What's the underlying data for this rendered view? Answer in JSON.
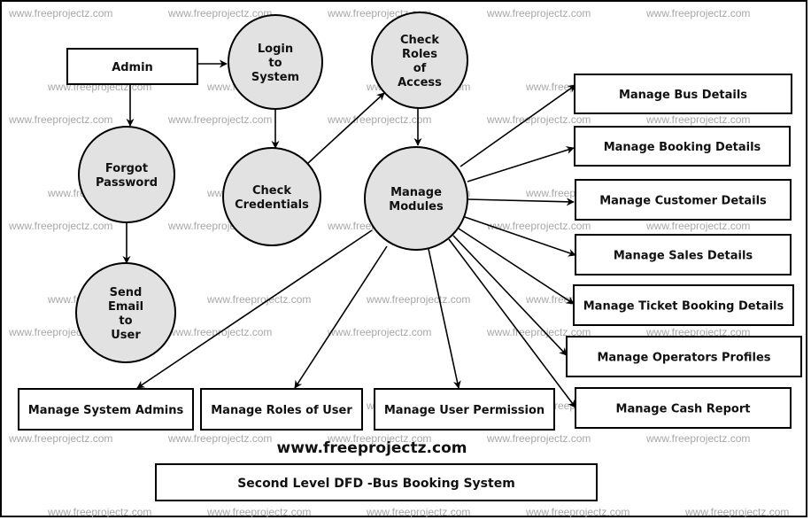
{
  "diagram": {
    "type": "Data Flow Diagram",
    "title": "Second Level DFD -Bus Booking System",
    "website": "www.freeprojectz.com",
    "watermark": "www.freeprojectz.com",
    "colors": {
      "process_fill": "#e2e2e2",
      "stroke": "#000000",
      "watermark": "#a8a8a8",
      "background": "#ffffff"
    },
    "entities": [
      {
        "id": "admin",
        "label": "Admin"
      },
      {
        "id": "bus",
        "label": "Manage Bus Details"
      },
      {
        "id": "booking",
        "label": "Manage Booking Details"
      },
      {
        "id": "customer",
        "label": "Manage Customer Details"
      },
      {
        "id": "sales",
        "label": "Manage Sales Details"
      },
      {
        "id": "ticket",
        "label": "Manage Ticket Booking Details"
      },
      {
        "id": "operators",
        "label": "Manage Operators Profiles"
      },
      {
        "id": "cash",
        "label": "Manage Cash Report"
      },
      {
        "id": "sysadmins",
        "label": "Manage System Admins"
      },
      {
        "id": "roles",
        "label": "Manage Roles of User"
      },
      {
        "id": "permission",
        "label": "Manage User Permission"
      }
    ],
    "processes": [
      {
        "id": "login",
        "lines": [
          "Login",
          "to",
          "System"
        ]
      },
      {
        "id": "checkroles",
        "lines": [
          "Check",
          "Roles",
          "of",
          "Access"
        ]
      },
      {
        "id": "forgot",
        "lines": [
          "Forgot",
          "Password"
        ]
      },
      {
        "id": "checkcred",
        "lines": [
          "Check",
          "Credentials"
        ]
      },
      {
        "id": "modules",
        "lines": [
          "Manage",
          "Modules"
        ]
      },
      {
        "id": "sendemail",
        "lines": [
          "Send",
          "Email",
          "to",
          "User"
        ]
      }
    ],
    "flows": [
      {
        "from": "admin",
        "to": "login"
      },
      {
        "from": "admin",
        "to": "forgot"
      },
      {
        "from": "login",
        "to": "checkcred"
      },
      {
        "from": "checkcred",
        "to": "checkroles"
      },
      {
        "from": "checkroles",
        "to": "modules"
      },
      {
        "from": "forgot",
        "to": "sendemail"
      },
      {
        "from": "modules",
        "to": "bus"
      },
      {
        "from": "modules",
        "to": "booking"
      },
      {
        "from": "modules",
        "to": "customer"
      },
      {
        "from": "modules",
        "to": "sales"
      },
      {
        "from": "modules",
        "to": "ticket"
      },
      {
        "from": "modules",
        "to": "operators"
      },
      {
        "from": "modules",
        "to": "cash"
      },
      {
        "from": "modules",
        "to": "sysadmins"
      },
      {
        "from": "modules",
        "to": "roles"
      },
      {
        "from": "modules",
        "to": "permission"
      }
    ]
  }
}
